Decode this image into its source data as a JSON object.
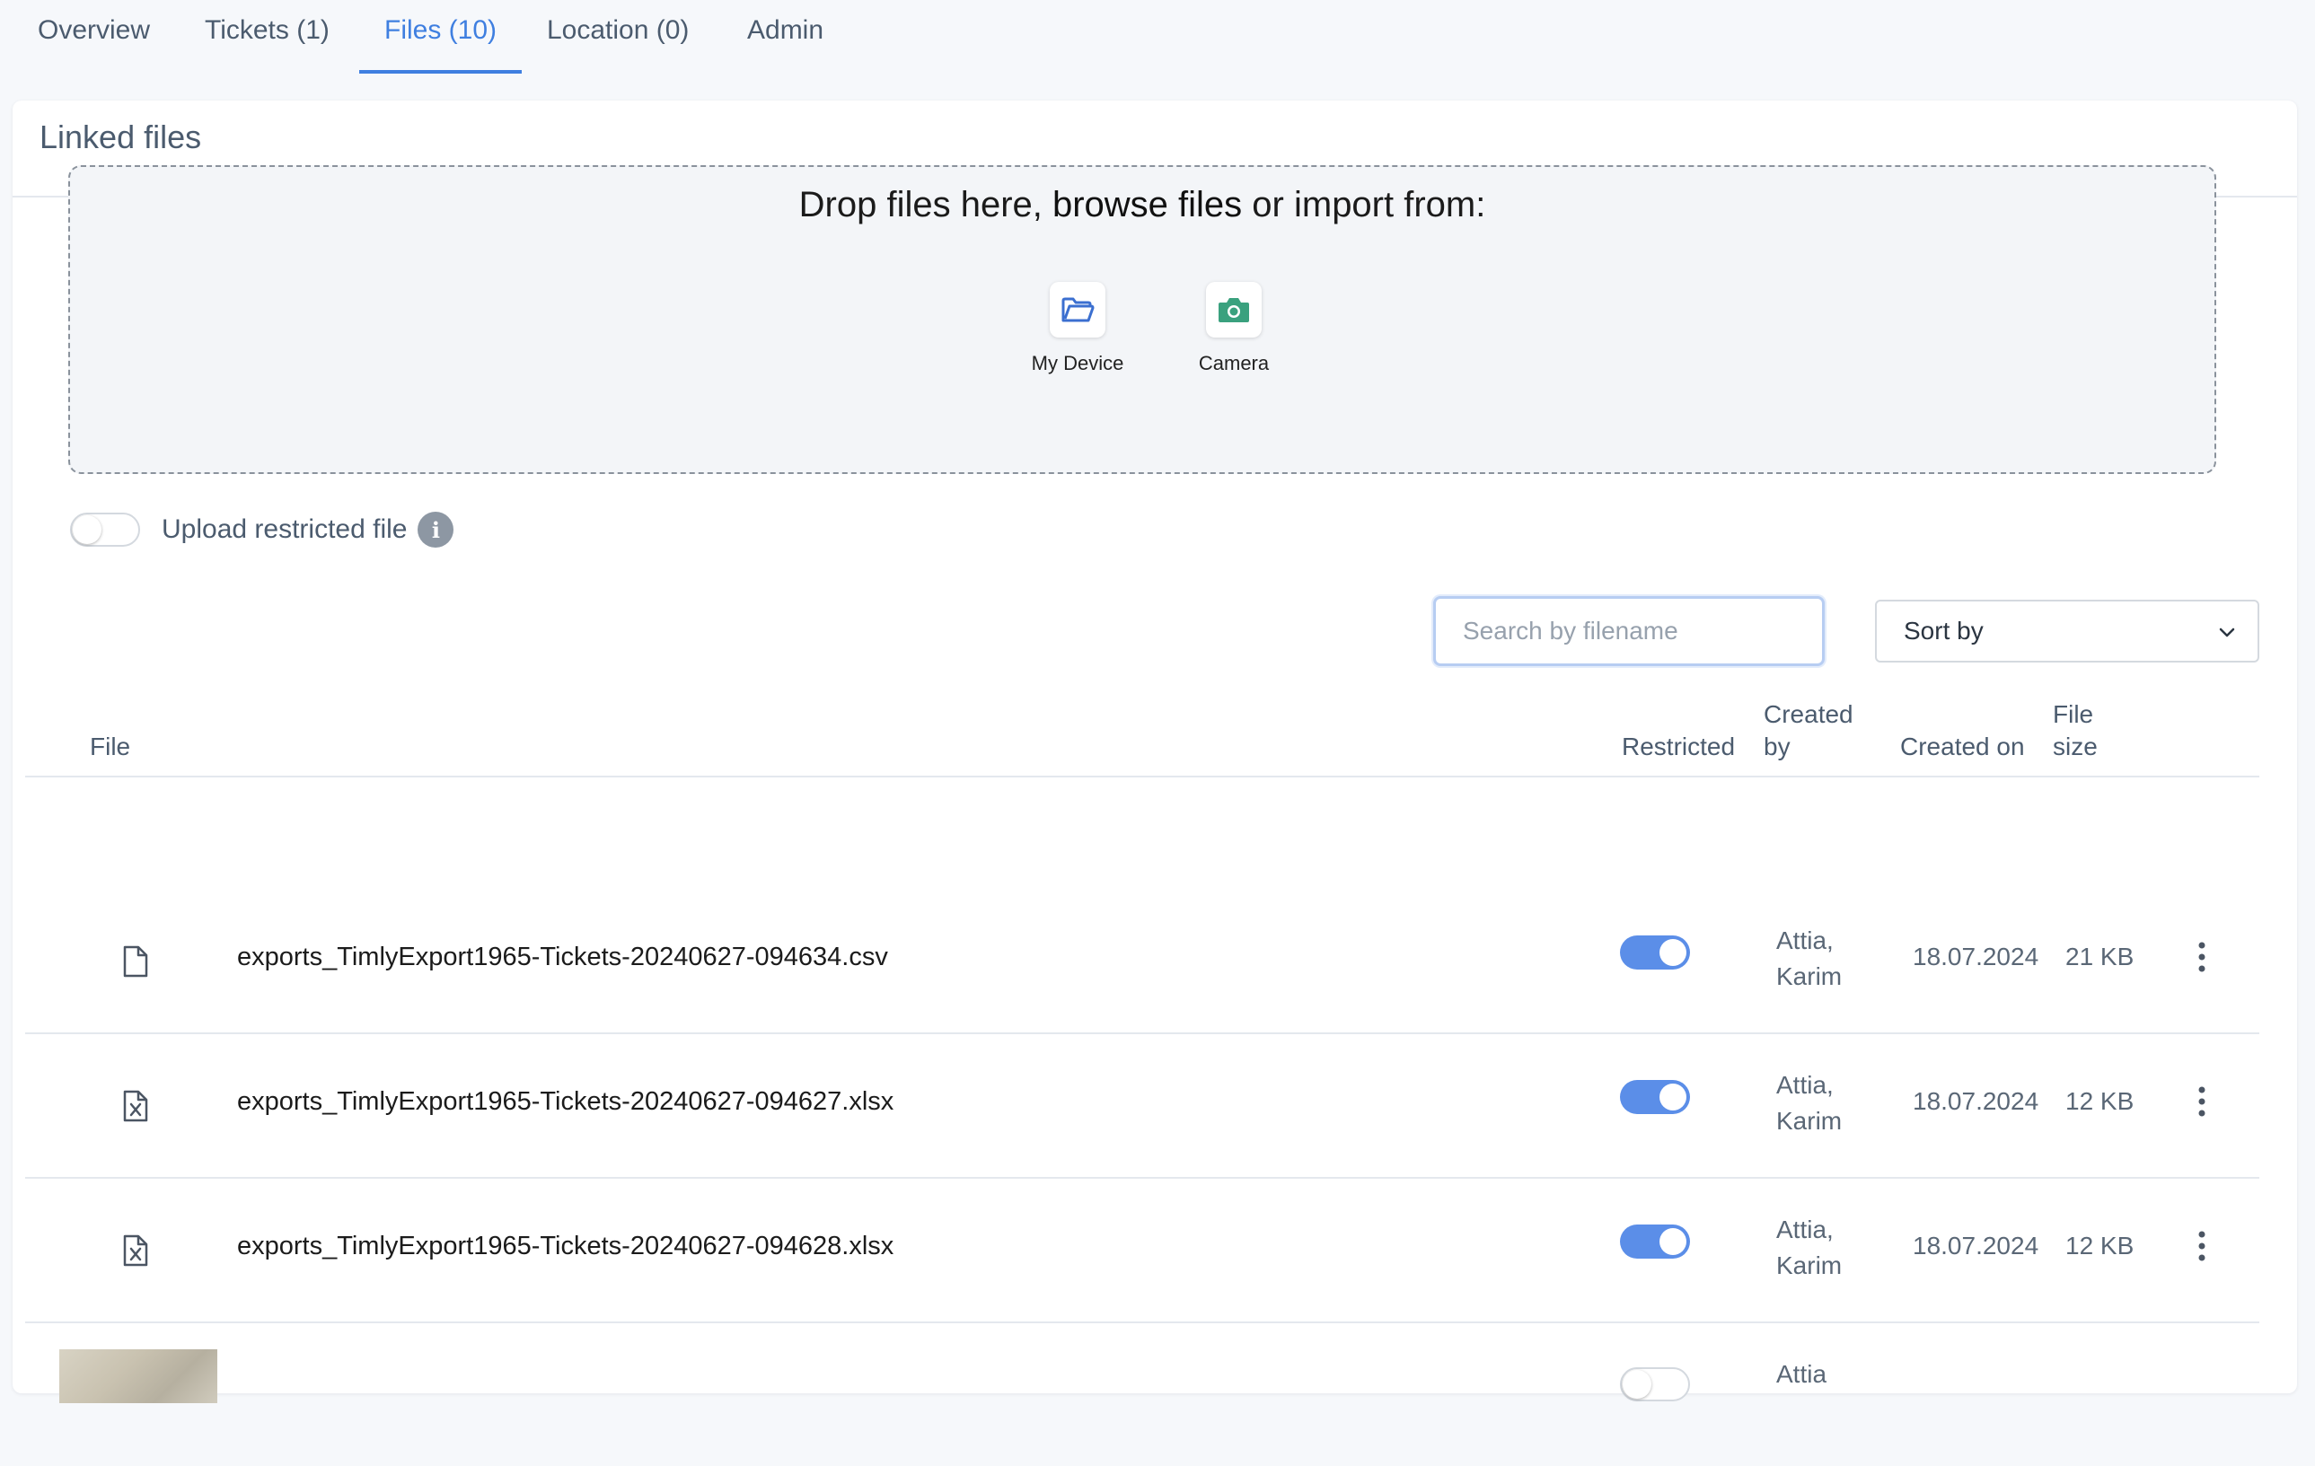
{
  "tabs": [
    {
      "label": "Overview",
      "active": false
    },
    {
      "label": "Tickets (1)",
      "active": false
    },
    {
      "label": "Files (10)",
      "active": true
    },
    {
      "label": "Location (0)",
      "active": false
    },
    {
      "label": "Admin",
      "active": false
    }
  ],
  "card": {
    "title": "Linked files"
  },
  "dropzone": {
    "text_before": "Drop files here, ",
    "browse_link": "browse files",
    "text_after": " or import from:",
    "sources": [
      {
        "label": "My Device",
        "icon": "folder-icon"
      },
      {
        "label": "Camera",
        "icon": "camera-icon"
      }
    ]
  },
  "upload_restricted": {
    "label": "Upload restricted file",
    "enabled": false,
    "info_icon": "info-icon",
    "info_glyph": "i"
  },
  "search": {
    "placeholder": "Search by filename",
    "value": ""
  },
  "sort": {
    "label": "Sort by"
  },
  "table": {
    "headers": {
      "file": "File",
      "restricted": "Restricted",
      "created_by_line1": "Created",
      "created_by_line2": "by",
      "created_on": "Created on",
      "file_size_line1": "File",
      "file_size_line2": "size"
    },
    "rows": [
      {
        "icon": "file-icon",
        "name": "exports_TimlyExport1965-Tickets-20240627-094634.csv",
        "restricted": true,
        "created_by_line1": "Attia,",
        "created_by_line2": "Karim",
        "created_on": "18.07.2024",
        "size": "21 KB"
      },
      {
        "icon": "excel-file-icon",
        "name": "exports_TimlyExport1965-Tickets-20240627-094627.xlsx",
        "restricted": true,
        "created_by_line1": "Attia,",
        "created_by_line2": "Karim",
        "created_on": "18.07.2024",
        "size": "12 KB"
      },
      {
        "icon": "excel-file-icon",
        "name": "exports_TimlyExport1965-Tickets-20240627-094628.xlsx",
        "restricted": true,
        "created_by_line1": "Attia,",
        "created_by_line2": "Karim",
        "created_on": "18.07.2024",
        "size": "12 KB"
      },
      {
        "icon": "image-thumbnail",
        "name": "",
        "restricted": false,
        "created_by_line1": "Attia",
        "created_by_line2": "",
        "created_on": "",
        "size": ""
      }
    ]
  },
  "colors": {
    "accent": "#3f7fe0",
    "toggle_on": "#5b8ee8",
    "camera_green": "#3aa17e",
    "folder_blue": "#3b6fd0"
  }
}
